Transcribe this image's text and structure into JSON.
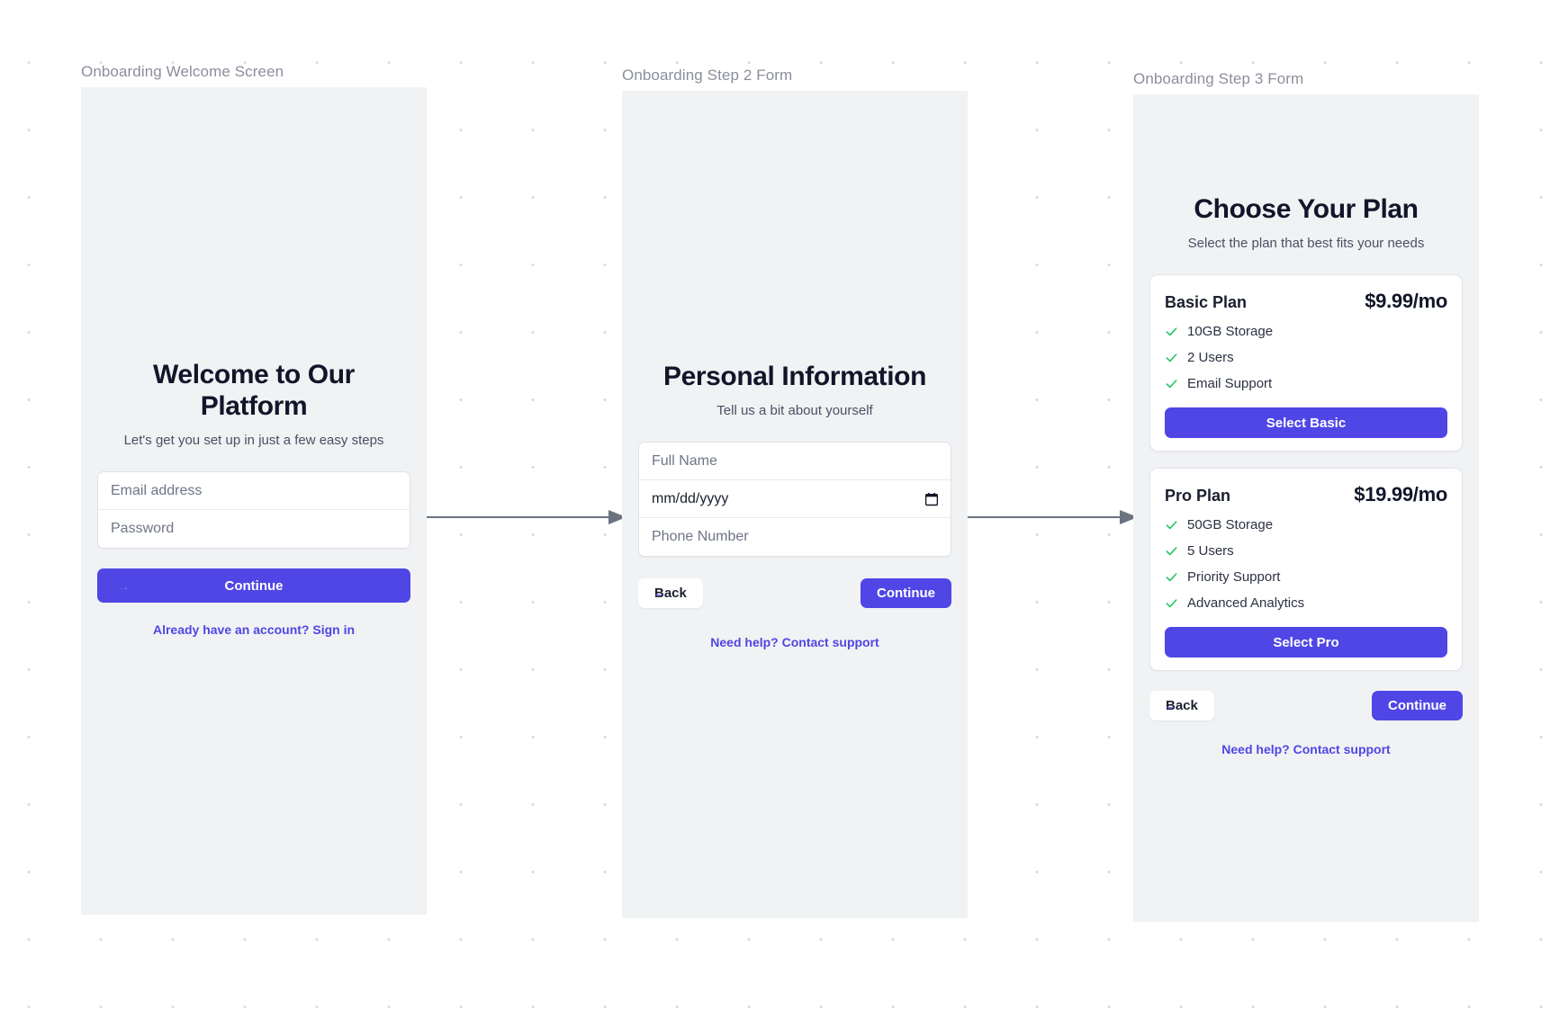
{
  "frames": [
    {
      "label": "Onboarding Welcome Screen",
      "title": "Welcome to Our Platform",
      "subtitle": "Let's get you set up in just a few easy steps",
      "fields": [
        {
          "placeholder": "Email address",
          "value": ""
        },
        {
          "placeholder": "Password",
          "value": ""
        }
      ],
      "primary_button": "Continue",
      "primary_button_icon": "arrow-right-icon",
      "signin_link": "Already have an account? Sign in"
    },
    {
      "label": "Onboarding Step 2 Form",
      "title": "Personal Information",
      "subtitle": "Tell us a bit about yourself",
      "fields": [
        {
          "placeholder": "Full Name",
          "value": ""
        },
        {
          "placeholder": "mm/dd/yyyy",
          "value": "",
          "icon": "calendar-icon"
        },
        {
          "placeholder": "Phone Number",
          "value": ""
        }
      ],
      "back_button": "Back",
      "continue_button": "Continue",
      "help_link": "Need help? Contact support"
    },
    {
      "label": "Onboarding Step 3 Form",
      "title": "Choose Your Plan",
      "subtitle": "Select the plan that best fits your needs",
      "plans": [
        {
          "name": "Basic Plan",
          "price": "$9.99/mo",
          "features": [
            "10GB Storage",
            "2 Users",
            "Email Support"
          ],
          "select_button": "Select Basic"
        },
        {
          "name": "Pro Plan",
          "price": "$19.99/mo",
          "features": [
            "50GB Storage",
            "5 Users",
            "Priority Support",
            "Advanced Analytics"
          ],
          "select_button": "Select Pro"
        }
      ],
      "back_button": "Back",
      "continue_button": "Continue",
      "help_link": "Need help? Contact support"
    }
  ],
  "icons": {
    "arrow_right": "→",
    "arrow_left": "←"
  },
  "colors": {
    "accent": "#4f46e5",
    "check_green": "#22c55e",
    "frame_bg": "#f1f2f4",
    "label_gray": "#8b8f9c",
    "heading": "#11162a",
    "connector": "#6b7280"
  }
}
